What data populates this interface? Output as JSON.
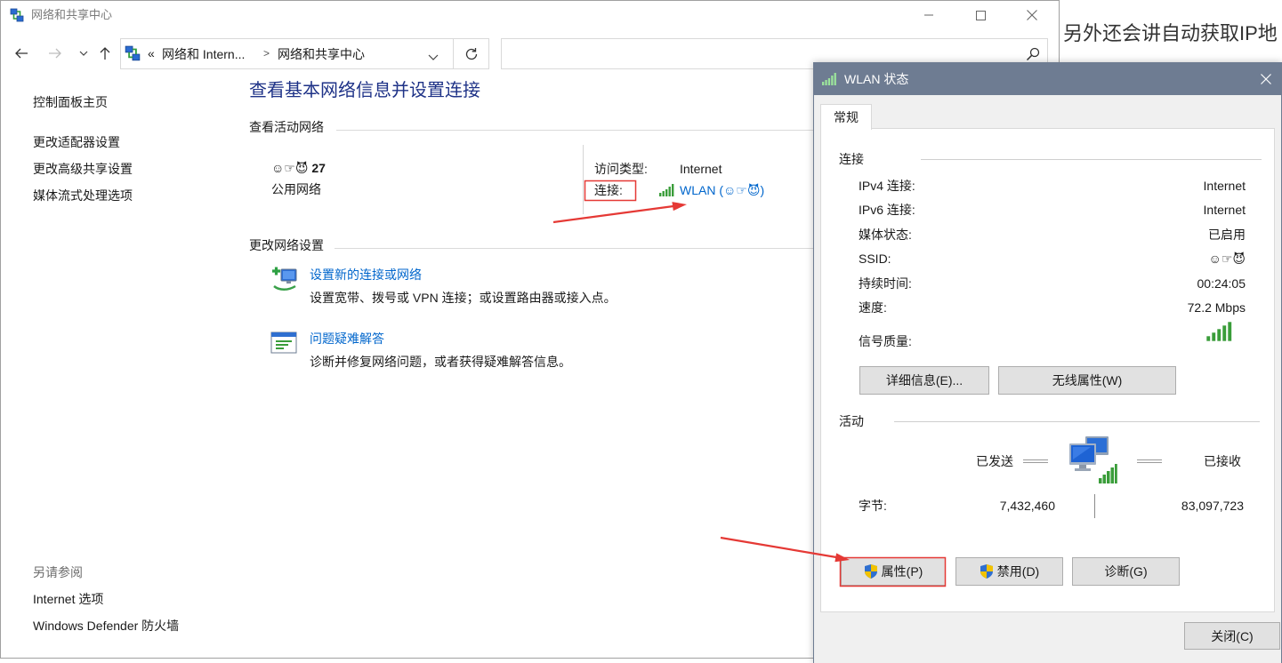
{
  "background_page": {
    "text": "另外还会讲自动获取IP地"
  },
  "main_window": {
    "title": "网络和共享中心",
    "address_bar": {
      "overflow_indicator": "«",
      "breadcrumbs": [
        "网络和 Intern...",
        "网络和共享中心"
      ],
      "separator": ">"
    },
    "search": {
      "value": ""
    },
    "sidebar": {
      "items": [
        "控制面板主页",
        "更改适配器设置",
        "更改高级共享设置",
        "媒体流式处理选项"
      ],
      "see_also_heading": "另请参阅",
      "see_also_links": [
        "Internet 选项",
        "Windows Defender 防火墙"
      ]
    },
    "heading": "查看基本网络信息并设置连接",
    "active_networks": {
      "section_title": "查看活动网络",
      "network_name": "☺☞😈 27",
      "network_category": "公用网络",
      "access_type_label": "访问类型:",
      "access_type_value": "Internet",
      "connections_label": "连接:",
      "connection_link": "WLAN (☺☞😈)"
    },
    "change_settings": {
      "section_title": "更改网络设置",
      "tasks": [
        {
          "title": "设置新的连接或网络",
          "description": "设置宽带、拨号或 VPN 连接；或设置路由器或接入点。"
        },
        {
          "title": "问题疑难解答",
          "description": "诊断并修复网络问题，或者获得疑难解答信息。"
        }
      ]
    }
  },
  "wlan_dialog": {
    "title": "WLAN 状态",
    "tabs": [
      "常规"
    ],
    "connection": {
      "heading": "连接",
      "rows": [
        {
          "label": "IPv4 连接:",
          "value": "Internet"
        },
        {
          "label": "IPv6 连接:",
          "value": "Internet"
        },
        {
          "label": "媒体状态:",
          "value": "已启用"
        },
        {
          "label": "SSID:",
          "value": "☺☞😈"
        },
        {
          "label": "持续时间:",
          "value": "00:24:05"
        },
        {
          "label": "速度:",
          "value": "72.2 Mbps"
        }
      ],
      "signal_quality_label": "信号质量:",
      "signal_bars": 5,
      "signal_bars_max": 5,
      "buttons": [
        "详细信息(E)...",
        "无线属性(W)"
      ]
    },
    "activity": {
      "heading": "活动",
      "sent_label": "已发送",
      "received_label": "已接收",
      "bytes_label": "字节:",
      "bytes_sent": "7,432,460",
      "bytes_received": "83,097,723"
    },
    "action_buttons": [
      "属性(P)",
      "禁用(D)",
      "诊断(G)"
    ],
    "close_button": "关闭(C)"
  },
  "icons": [
    "network-sharing-center-icon",
    "minimize-icon",
    "maximize-icon",
    "close-icon",
    "back-arrow-icon",
    "forward-arrow-icon",
    "recent-locations-icon",
    "up-arrow-icon",
    "control-panel-network-icon",
    "chevron-down-icon",
    "refresh-icon",
    "search-icon",
    "wifi-signal-icon",
    "setup-connection-icon",
    "troubleshoot-icon",
    "uac-shield-icon",
    "network-activity-icon"
  ],
  "colors": {
    "link": "#0066cc",
    "heading": "#1e3287",
    "dialog_title_bar": "#6e7c92",
    "annotation": "#e53935",
    "signal_green": "#3a9d3a",
    "signal_off": "#cfcfcf"
  }
}
